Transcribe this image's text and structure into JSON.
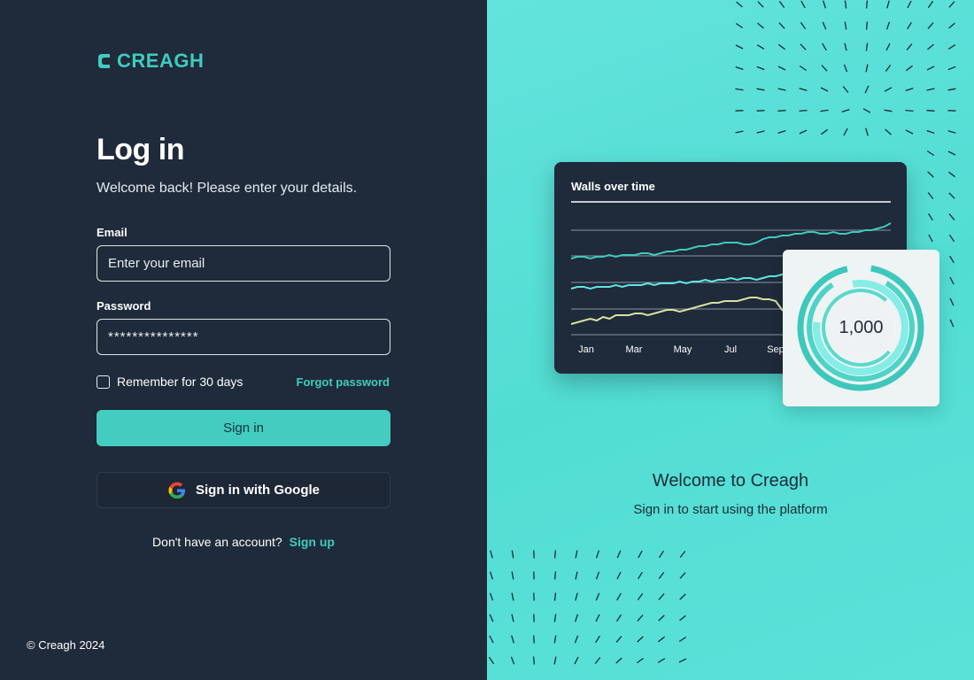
{
  "brand": {
    "name": "CREAGH",
    "accent": "#40cbbf"
  },
  "login": {
    "title": "Log in",
    "subtitle": "Welcome back! Please enter your details.",
    "email": {
      "label": "Email",
      "placeholder": "Enter your email",
      "value": ""
    },
    "password": {
      "label": "Password",
      "value": "***************"
    },
    "remember_label": "Remember for 30 days",
    "remember_checked": false,
    "forgot_label": "Forgot password",
    "signin_label": "Sign in",
    "google_label": "Sign in with Google",
    "google_icon": "google-icon",
    "signup_prompt": "Don't have an account?",
    "signup_label": "Sign up"
  },
  "footer": {
    "copyright": "© Creagh 2024"
  },
  "showcase": {
    "welcome_title": "Welcome to Creagh",
    "welcome_subtitle": "Sign in to start using the platform",
    "kpi_value": "1,000"
  },
  "chart_data": {
    "type": "line",
    "title": "Walls over time",
    "categories": [
      "Jan",
      "Mar",
      "May",
      "Jul",
      "Sep"
    ],
    "x": [
      0,
      1,
      2,
      3,
      4,
      5,
      6,
      7,
      8,
      9,
      10,
      11,
      12,
      13,
      14,
      15,
      16,
      17,
      18,
      19,
      20,
      21,
      22,
      23,
      24,
      25,
      26,
      27,
      28,
      29,
      30,
      31,
      32,
      33,
      34,
      35,
      36,
      37,
      38,
      39,
      40,
      41,
      42,
      43,
      44,
      45,
      46,
      47,
      48,
      49,
      50
    ],
    "series": [
      {
        "color": "#3fc9bb",
        "values": [
          10,
          11,
          11,
          10,
          11,
          11,
          12,
          11,
          12,
          12,
          12,
          13,
          13,
          12,
          13,
          14,
          14,
          15,
          15,
          16,
          17,
          17,
          18,
          18,
          19,
          19,
          19,
          18,
          18,
          19,
          21,
          22,
          22,
          23,
          23,
          24,
          24,
          25,
          25,
          24,
          24,
          25,
          24,
          24,
          25,
          25,
          26,
          26,
          27,
          28,
          30
        ]
      },
      {
        "color": "#5fe6e2",
        "values": [
          -7,
          -6,
          -6,
          -7,
          -6,
          -6,
          -6,
          -5,
          -6,
          -5,
          -5,
          -5,
          -4,
          -5,
          -4,
          -4,
          -4,
          -3,
          -4,
          -3,
          -3,
          -2,
          -3,
          -2,
          -2,
          -1,
          -2,
          -1,
          -1,
          -2,
          -1,
          0,
          0,
          1,
          1,
          2,
          2,
          3,
          3,
          4,
          4,
          5,
          5,
          6,
          6,
          7,
          7,
          8,
          8,
          9,
          9
        ]
      },
      {
        "color": "#d6e2a0",
        "values": [
          -27,
          -26,
          -25,
          -24,
          -25,
          -23,
          -24,
          -22,
          -22,
          -22,
          -21,
          -21,
          -22,
          -21,
          -20,
          -19,
          -19,
          -20,
          -19,
          -18,
          -17,
          -16,
          -15,
          -15,
          -14,
          -14,
          -14,
          -13,
          -12,
          -12,
          -13,
          -13,
          -14,
          -19,
          -21,
          -17,
          -14,
          -13,
          -12,
          -11,
          -10,
          -9,
          -8,
          -7,
          -6,
          -5,
          -4,
          -3,
          -2,
          -1,
          0
        ]
      }
    ],
    "ylim": [
      -32,
      36
    ],
    "grid": true
  }
}
